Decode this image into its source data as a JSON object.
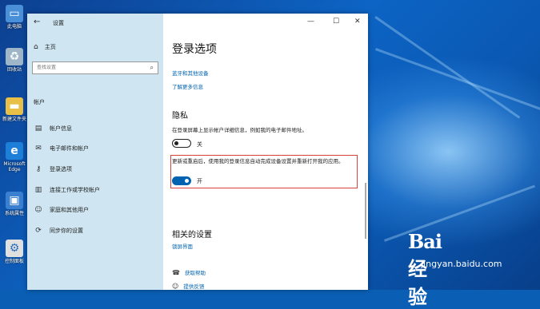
{
  "desktop": {
    "icons": [
      {
        "label": "此电脑",
        "icon": "computer-icon",
        "color": "#4a90d9"
      },
      {
        "label": "回收站",
        "icon": "recycle-bin-icon",
        "color": "#9fb6c8"
      },
      {
        "label": "新建文件夹",
        "icon": "folder-icon",
        "color": "#e8c048"
      },
      {
        "label": "Microsoft Edge",
        "icon": "edge-icon",
        "color": "#1e7fd8"
      },
      {
        "label": "系统属性",
        "icon": "system-icon",
        "color": "#3a7fd0"
      },
      {
        "label": "控制面板",
        "icon": "control-panel-icon",
        "color": "#e0e0e0"
      }
    ]
  },
  "window": {
    "title": "设置",
    "controls": {
      "minimize": "—",
      "maximize": "☐",
      "close": "✕"
    }
  },
  "sidebar": {
    "home_label": "主页",
    "search_placeholder": "查找设置",
    "section_title": "帐户",
    "items": [
      {
        "label": "帐户信息",
        "icon": "person-card-icon"
      },
      {
        "label": "电子邮件和帐户",
        "icon": "mail-icon"
      },
      {
        "label": "登录选项",
        "icon": "key-icon",
        "selected": true
      },
      {
        "label": "连接工作或学校帐户",
        "icon": "briefcase-icon"
      },
      {
        "label": "家庭和其他用户",
        "icon": "people-icon"
      },
      {
        "label": "同步你的设置",
        "icon": "sync-icon"
      }
    ]
  },
  "content": {
    "page_title": "登录选项",
    "link_bluetooth": "蓝牙和其他设备",
    "link_learn_more": "了解更多信息",
    "privacy_title": "隐私",
    "privacy_desc": "在登录屏幕上显示帐户详细信息，例如我的电子邮件地址。",
    "privacy_toggle_state": "关",
    "update_desc": "更新或重启后，使用我的登录信息自动完成设备设置并重新打开我的应用。",
    "update_toggle_state": "开",
    "related_title": "相关的设置",
    "link_lock_screen": "锁屏界面",
    "help_get": "获取帮助",
    "help_feedback": "提供反馈",
    "accent_color": "#0063b1",
    "highlight_color": "#d9403a"
  },
  "watermark": {
    "logo": "Bai 经验",
    "url": "jingyan.baidu.com"
  }
}
